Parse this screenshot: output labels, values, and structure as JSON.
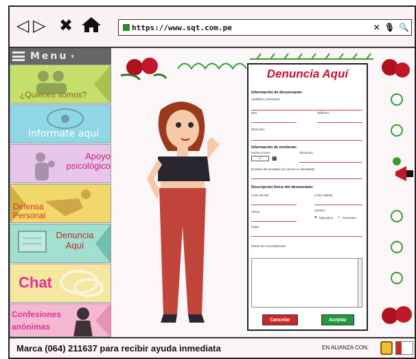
{
  "browser": {
    "url": "https://www.sqt.com.pe",
    "back_icon": "back-arrow-icon",
    "forward_icon": "forward-arrow-icon",
    "close_icon": "close-icon",
    "home_icon": "home-icon",
    "url_close": "✕",
    "mic_glyph": "🎙",
    "search_glyph": "🔍"
  },
  "sidebar": {
    "menu_label": "Menu",
    "items": [
      {
        "label": "¿Quienes somos?",
        "bg": "#c5e06a"
      },
      {
        "label": "Informate aquí",
        "bg": "#8fd6e6"
      },
      {
        "label": "Apoyo psicológico",
        "bg": "#e8c6ea"
      },
      {
        "label": "Defensa Personal",
        "bg": "#f2d86a"
      },
      {
        "label": "Denuncia Aquí",
        "bg": "#9fe0d0"
      },
      {
        "label": "Chat",
        "bg": "#f5e6a0"
      },
      {
        "label": "Confesiones anónimas",
        "bg": "#f4b8d2"
      }
    ]
  },
  "form": {
    "title": "Denuncia Aquí",
    "section1": "Información de denunciante:",
    "apellidos": "Apellidos y Nombres:",
    "dni": "DNI:",
    "telefono": "Teléfono:",
    "direccion": "Dirección:",
    "section2": "Información de incidente:",
    "fecha": "Fecha y Hora:",
    "ubicacion": "Ubicación:",
    "nombre_agresor": "Nombre del acosador (si conoce su identidad):",
    "section3": "Descripción física del denunciado:",
    "color_piel": "Color de piel:",
    "color_cabello": "Color cabello:",
    "altura": "Altura:",
    "genero": "Género:",
    "masculino": "Masculino",
    "femenino": "Femenino",
    "ropa": "Ropa:",
    "narrar": "Narrar las circunstancias:",
    "cancel": "Cancelar",
    "accept": "Aceptar"
  },
  "footer": {
    "text": "Marca (064) 211637 para recibir ayuda inmediata",
    "alianza": "EN ALIANZA CON:"
  },
  "colors": {
    "accent_red": "#c8102e",
    "accept_green": "#1f9a3a",
    "cancel_red": "#c82828"
  }
}
